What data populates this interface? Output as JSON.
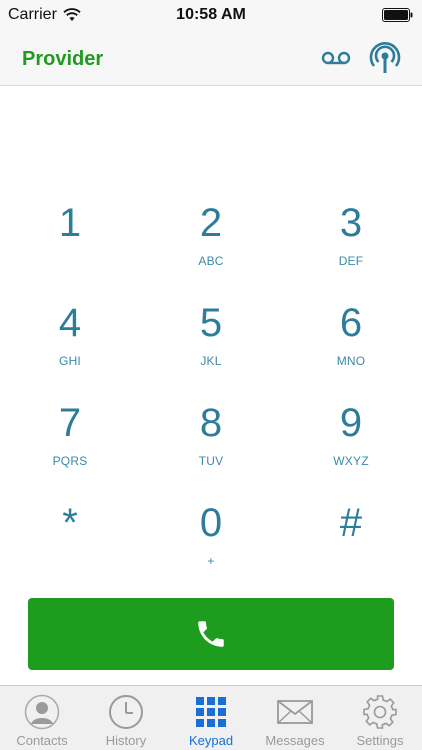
{
  "status_bar": {
    "carrier": "Carrier",
    "time": "10:58 AM"
  },
  "nav_bar": {
    "title": "Provider",
    "title_color": "#1f9b1f",
    "voicemail_icon": "voicemail-icon",
    "antenna_icon": "antenna-icon"
  },
  "keypad": {
    "keys": [
      {
        "digit": "1",
        "letters": ""
      },
      {
        "digit": "2",
        "letters": "ABC"
      },
      {
        "digit": "3",
        "letters": "DEF"
      },
      {
        "digit": "4",
        "letters": "GHI"
      },
      {
        "digit": "5",
        "letters": "JKL"
      },
      {
        "digit": "6",
        "letters": "MNO"
      },
      {
        "digit": "7",
        "letters": "PQRS"
      },
      {
        "digit": "8",
        "letters": "TUV"
      },
      {
        "digit": "9",
        "letters": "WXYZ"
      },
      {
        "digit": "*",
        "letters": ""
      },
      {
        "digit": "0",
        "letters": "+"
      },
      {
        "digit": "#",
        "letters": ""
      }
    ],
    "key_color": "#2d7d9a"
  },
  "call_button": {
    "icon": "phone-icon",
    "color": "#1d9c1d"
  },
  "tab_bar": {
    "tabs": [
      {
        "label": "Contacts",
        "icon": "contacts-icon",
        "active": false
      },
      {
        "label": "History",
        "icon": "clock-icon",
        "active": false
      },
      {
        "label": "Keypad",
        "icon": "keypad-icon",
        "active": true
      },
      {
        "label": "Messages",
        "icon": "envelope-icon",
        "active": false
      },
      {
        "label": "Settings",
        "icon": "gear-icon",
        "active": false
      }
    ],
    "active_color": "#1a6fd6"
  }
}
